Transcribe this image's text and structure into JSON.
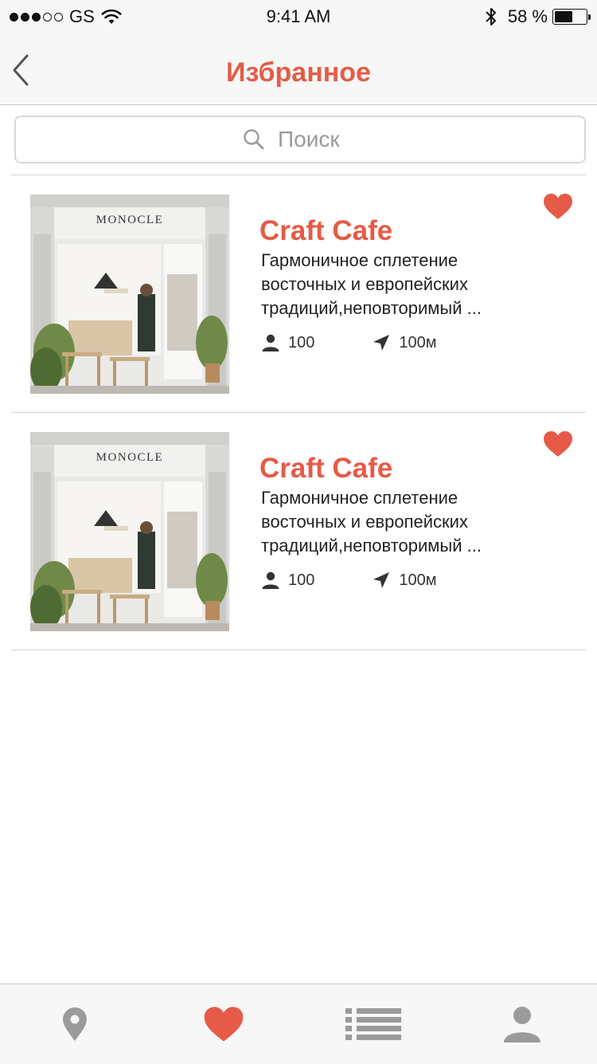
{
  "status_bar": {
    "carrier": "GS",
    "time": "9:41 AM",
    "battery_text": "58 %",
    "battery_level": 0.58
  },
  "nav": {
    "title": "Избранное",
    "back_icon": "chevron-left-icon"
  },
  "search": {
    "placeholder": "Поиск",
    "icon": "search-icon"
  },
  "items": [
    {
      "title": "Craft Cafe",
      "description": "Гармоничное сплетение восточных и европейских традиций,неповторимый ...",
      "capacity": "100",
      "distance": "100м",
      "favorite": true,
      "photo_sign": "MONOCLE"
    },
    {
      "title": "Craft Cafe",
      "description": "Гармоничное сплетение восточных и европейских традиций,неповторимый ...",
      "capacity": "100",
      "distance": "100м",
      "favorite": true,
      "photo_sign": "MONOCLE"
    }
  ],
  "tab_bar": {
    "tabs": [
      {
        "icon": "map-pin-icon",
        "active": false
      },
      {
        "icon": "heart-icon",
        "active": true
      },
      {
        "icon": "list-icon",
        "active": false
      },
      {
        "icon": "profile-icon",
        "active": false
      }
    ]
  },
  "colors": {
    "accent": "#e55b47",
    "inactive_icon": "#9b9b9b",
    "bar_background": "#f7f7f7",
    "divider": "#d4d4d4"
  }
}
